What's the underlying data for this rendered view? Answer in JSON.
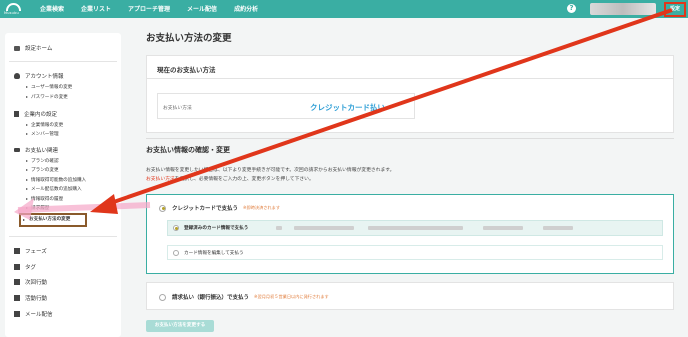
{
  "topbar": {
    "logo_text": "Musubu",
    "nav": [
      "企業検索",
      "企業リスト",
      "アプローチ管理",
      "メール配信",
      "成約分析"
    ],
    "help_icon": "?",
    "settings_label": "設定"
  },
  "sidebar": {
    "home": "設定ホーム",
    "account": {
      "title": "アカウント情報",
      "items": [
        "ユーザー情報の変更",
        "パスワードの変更"
      ]
    },
    "company": {
      "title": "企業内の設定",
      "items": [
        "企業情報の変更",
        "メンバー管理"
      ]
    },
    "payment": {
      "title": "お支払い関連",
      "items": [
        "プランの確認",
        "プランの変更",
        "情報取得可能数の追加購入",
        "メール配信数の追加購入",
        "情報取得の履歴",
        "請求履歴"
      ],
      "active": "お支払い方法の変更"
    },
    "bottom": [
      "フェーズ",
      "タグ",
      "次回行動",
      "活動行動",
      "メール配信"
    ]
  },
  "main": {
    "title": "お支払い方法の変更",
    "current": {
      "heading": "現在のお支払い方法",
      "label": "お支払い方法",
      "value": "クレジットカード払い"
    },
    "section_title": "お支払い情報の確認・変更",
    "desc_line1": "お支払い情報を変更したい場合は、以下より変更手続きが可能です。次回の請求からお支払い情報が変更されます。",
    "desc_line2_red": "お支払い方法",
    "desc_line2": "を選択し、必要情報をご入力の上、変更ボタンを押して下さい。",
    "card_option": {
      "label": "クレジットカードで支払う",
      "note": "※即時決済されます",
      "registered": "登録済みのカード情報で支払う",
      "edit": "カード情報を編集して支払う"
    },
    "invoice_option": {
      "label": "請求払い（銀行振込）で支払う",
      "note": "※翌月月初５営業日以内に発行されます"
    },
    "submit": "お支払い方法を変更する"
  },
  "colors": {
    "brand": "#3aaea3",
    "annotation_red": "#e0361b",
    "annotation_brown": "#8a5a2b",
    "link_blue": "#2f9fd6"
  }
}
